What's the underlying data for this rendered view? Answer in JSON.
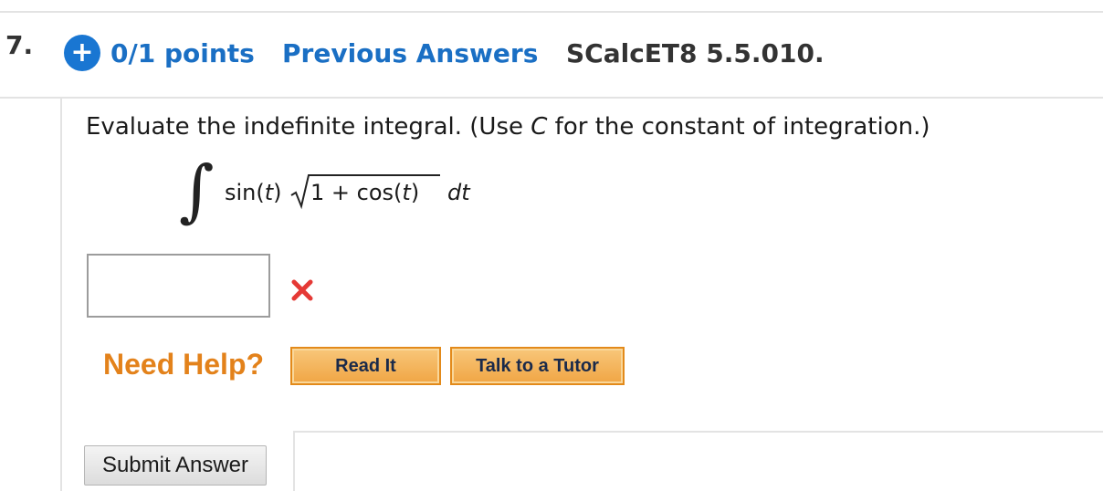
{
  "header": {
    "question_number": "7.",
    "expand_icon": "plus-circle-icon",
    "points": "0/1 points",
    "previous_answers": "Previous Answers",
    "reference": "SCalcET8 5.5.010."
  },
  "question": {
    "instruction_before": "Evaluate the indefinite integral. (Use ",
    "instruction_var": "C",
    "instruction_after": " for the constant of integration.)",
    "integral_symbol": "∫",
    "expr_sin": "sin(",
    "expr_t": "t",
    "expr_close": ")",
    "radicand_prefix": "1 + cos(",
    "radicand_t": "t",
    "radicand_close": ")",
    "differential": "dt"
  },
  "answer": {
    "value": "",
    "status_icon": "incorrect-x-icon",
    "status_color": "#e53935"
  },
  "help": {
    "label": "Need Help?",
    "read_it": "Read It",
    "talk_to_tutor": "Talk to a Tutor"
  },
  "actions": {
    "submit": "Submit Answer"
  },
  "colors": {
    "link_blue": "#1a6fc4",
    "plus_blue": "#1976d2",
    "help_orange": "#e3821b",
    "button_orange": "#f0a544"
  }
}
